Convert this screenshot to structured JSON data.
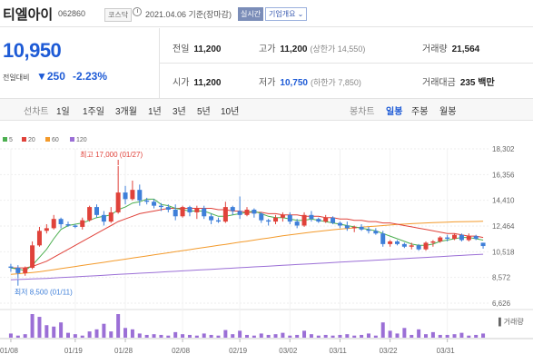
{
  "header": {
    "name": "티엘아이",
    "code": "062860",
    "market": "코스닥",
    "date": "2021.04.06 기준(장마감)",
    "live_btn": "실시간",
    "profile_btn": "기업개요 ⌄"
  },
  "price": {
    "current": "10,950",
    "change_label": "전일대비",
    "change": "▼250",
    "change_pct": "-2.23%"
  },
  "stats": {
    "prev_label": "전일",
    "prev": "11,200",
    "high_label": "고가",
    "high": "11,200",
    "high_sub": "(상한가 14,550)",
    "volume_label": "거래량",
    "volume": "21,564",
    "open_label": "시가",
    "open": "11,200",
    "low_label": "저가",
    "low": "10,750",
    "low_sub": "(하한가 7,850)",
    "amount_label": "거래대금",
    "amount": "235 백만"
  },
  "tabs": {
    "line": "선차트",
    "d1": "1일",
    "w1": "1주일",
    "m3": "3개월",
    "y1": "1년",
    "y3": "3년",
    "y5": "5년",
    "y10": "10년",
    "candle": "봉차트",
    "daily": "일봉",
    "weekly": "주봉",
    "monthly": "월봉"
  },
  "legend": [
    {
      "label": "5",
      "color": "#4caf50"
    },
    {
      "label": "20",
      "color": "#e0423a"
    },
    {
      "label": "60",
      "color": "#f39a2b"
    },
    {
      "label": "120",
      "color": "#9b6fd6"
    }
  ],
  "colors": {
    "up": "#e0423a",
    "down": "#3e7fd9",
    "volume": "#9b6fd6"
  },
  "chart_data": {
    "type": "candlestick",
    "y_ticks": [
      "18,302",
      "16,356",
      "14,410",
      "12,464",
      "10,518",
      "8,572",
      "6,626"
    ],
    "x_ticks": [
      "01/08",
      "01/19",
      "01/28",
      "02/08",
      "02/19",
      "03/02",
      "03/11",
      "03/22",
      "03/31"
    ],
    "ylim": [
      6626,
      18302
    ],
    "high_annotation": "최고 17,000 (01/27)",
    "low_annotation": "최저 8,500 (01/11)",
    "volume_label": "▌거래량",
    "candles": [
      {
        "o": 9400,
        "h": 9600,
        "l": 9000,
        "c": 9300
      },
      {
        "o": 9300,
        "h": 9500,
        "l": 8500,
        "c": 8900
      },
      {
        "o": 8900,
        "h": 9400,
        "l": 8700,
        "c": 9300
      },
      {
        "o": 9300,
        "h": 11300,
        "l": 9200,
        "c": 11000
      },
      {
        "o": 11000,
        "h": 12400,
        "l": 10900,
        "c": 12100
      },
      {
        "o": 12100,
        "h": 12600,
        "l": 11900,
        "c": 12300
      },
      {
        "o": 12300,
        "h": 13300,
        "l": 12200,
        "c": 13000
      },
      {
        "o": 13000,
        "h": 13100,
        "l": 12300,
        "c": 12600
      },
      {
        "o": 12600,
        "h": 12800,
        "l": 12400,
        "c": 12500
      },
      {
        "o": 12500,
        "h": 12600,
        "l": 12300,
        "c": 12400
      },
      {
        "o": 12400,
        "h": 13100,
        "l": 12200,
        "c": 12900
      },
      {
        "o": 12900,
        "h": 14000,
        "l": 12800,
        "c": 13900
      },
      {
        "o": 13900,
        "h": 14100,
        "l": 13100,
        "c": 13300
      },
      {
        "o": 13300,
        "h": 13600,
        "l": 12500,
        "c": 12800
      },
      {
        "o": 12800,
        "h": 13900,
        "l": 12700,
        "c": 13500
      },
      {
        "o": 13500,
        "h": 17000,
        "l": 13400,
        "c": 15000
      },
      {
        "o": 15000,
        "h": 15500,
        "l": 14100,
        "c": 14500
      },
      {
        "o": 14500,
        "h": 15900,
        "l": 14400,
        "c": 15200
      },
      {
        "o": 15200,
        "h": 15600,
        "l": 14000,
        "c": 14400
      },
      {
        "o": 14400,
        "h": 14600,
        "l": 14100,
        "c": 14300
      },
      {
        "o": 14300,
        "h": 14500,
        "l": 13800,
        "c": 14000
      },
      {
        "o": 14000,
        "h": 14200,
        "l": 13600,
        "c": 13900
      },
      {
        "o": 13900,
        "h": 14100,
        "l": 13500,
        "c": 13700
      },
      {
        "o": 13700,
        "h": 14100,
        "l": 12900,
        "c": 13200
      },
      {
        "o": 13200,
        "h": 14000,
        "l": 13100,
        "c": 13900
      },
      {
        "o": 13900,
        "h": 14000,
        "l": 13200,
        "c": 13500
      },
      {
        "o": 13500,
        "h": 14000,
        "l": 13000,
        "c": 13800
      },
      {
        "o": 13800,
        "h": 14000,
        "l": 13000,
        "c": 13200
      },
      {
        "o": 13200,
        "h": 13400,
        "l": 12600,
        "c": 12900
      },
      {
        "o": 12900,
        "h": 13100,
        "l": 12700,
        "c": 12800
      },
      {
        "o": 12800,
        "h": 14300,
        "l": 12700,
        "c": 13900
      },
      {
        "o": 13900,
        "h": 14000,
        "l": 13300,
        "c": 13600
      },
      {
        "o": 13600,
        "h": 14700,
        "l": 13000,
        "c": 13300
      },
      {
        "o": 13300,
        "h": 13900,
        "l": 13200,
        "c": 13700
      },
      {
        "o": 13700,
        "h": 13800,
        "l": 13100,
        "c": 13400
      },
      {
        "o": 13400,
        "h": 13500,
        "l": 12700,
        "c": 12900
      },
      {
        "o": 12900,
        "h": 13000,
        "l": 12500,
        "c": 12800
      },
      {
        "o": 12800,
        "h": 13300,
        "l": 12600,
        "c": 13100
      },
      {
        "o": 13100,
        "h": 13500,
        "l": 12800,
        "c": 13300
      },
      {
        "o": 13300,
        "h": 13500,
        "l": 12600,
        "c": 12800
      },
      {
        "o": 12800,
        "h": 13000,
        "l": 12300,
        "c": 12500
      },
      {
        "o": 12500,
        "h": 13500,
        "l": 12400,
        "c": 13300
      },
      {
        "o": 13300,
        "h": 13600,
        "l": 12800,
        "c": 13000
      },
      {
        "o": 13000,
        "h": 13100,
        "l": 12700,
        "c": 12800
      },
      {
        "o": 12800,
        "h": 13300,
        "l": 12700,
        "c": 13100
      },
      {
        "o": 13100,
        "h": 13200,
        "l": 12600,
        "c": 12700
      },
      {
        "o": 12700,
        "h": 12800,
        "l": 12300,
        "c": 12500
      },
      {
        "o": 12500,
        "h": 12800,
        "l": 12100,
        "c": 12300
      },
      {
        "o": 12300,
        "h": 12500,
        "l": 12000,
        "c": 12400
      },
      {
        "o": 12400,
        "h": 12600,
        "l": 12100,
        "c": 12200
      },
      {
        "o": 12200,
        "h": 12400,
        "l": 11900,
        "c": 12100
      },
      {
        "o": 12100,
        "h": 12300,
        "l": 11800,
        "c": 11900
      },
      {
        "o": 11900,
        "h": 12100,
        "l": 10900,
        "c": 11100
      },
      {
        "o": 11100,
        "h": 11400,
        "l": 10900,
        "c": 11300
      },
      {
        "o": 11300,
        "h": 11400,
        "l": 11000,
        "c": 11100
      },
      {
        "o": 11100,
        "h": 11200,
        "l": 10800,
        "c": 10900
      },
      {
        "o": 10900,
        "h": 11200,
        "l": 10700,
        "c": 11000
      },
      {
        "o": 11000,
        "h": 11100,
        "l": 10600,
        "c": 10700
      },
      {
        "o": 10700,
        "h": 11300,
        "l": 10600,
        "c": 11200
      },
      {
        "o": 11200,
        "h": 11400,
        "l": 10900,
        "c": 11300
      },
      {
        "o": 11300,
        "h": 11700,
        "l": 11200,
        "c": 11600
      },
      {
        "o": 11600,
        "h": 11800,
        "l": 11300,
        "c": 11500
      },
      {
        "o": 11500,
        "h": 11900,
        "l": 11400,
        "c": 11800
      },
      {
        "o": 11800,
        "h": 11900,
        "l": 11300,
        "c": 11400
      },
      {
        "o": 11400,
        "h": 11900,
        "l": 11300,
        "c": 11700
      },
      {
        "o": 11700,
        "h": 11800,
        "l": 11400,
        "c": 11500
      },
      {
        "o": 11200,
        "h": 11200,
        "l": 10750,
        "c": 10950
      }
    ],
    "volumes": [
      6,
      3,
      5,
      34,
      30,
      18,
      16,
      22,
      7,
      5,
      3,
      9,
      12,
      20,
      9,
      34,
      14,
      12,
      6,
      4,
      5,
      4,
      3,
      8,
      5,
      4,
      3,
      6,
      4,
      3,
      11,
      5,
      10,
      4,
      3,
      6,
      4,
      5,
      7,
      3,
      4,
      10,
      5,
      3,
      4,
      3,
      4,
      5,
      3,
      4,
      6,
      3,
      22,
      10,
      6,
      14,
      4,
      12,
      5,
      8,
      4,
      4,
      5,
      7,
      3,
      4,
      6
    ],
    "ma5": [
      9300,
      9200,
      9100,
      9500,
      10100,
      10700,
      11500,
      12200,
      12500,
      12600,
      12700,
      12900,
      13100,
      13200,
      13300,
      13700,
      13900,
      14200,
      14300,
      14500,
      14500,
      14100,
      14000,
      13800,
      13700,
      13600,
      13600,
      13600,
      13400,
      13200,
      13200,
      13300,
      13400,
      13500,
      13600,
      13400,
      13200,
      13100,
      13100,
      13000,
      12900,
      12900,
      13000,
      12900,
      12800,
      12700,
      12600,
      12500,
      12400,
      12300,
      12200,
      12100,
      11900,
      11700,
      11500,
      11300,
      11100,
      11000,
      11000,
      11100,
      11300,
      11400,
      11500,
      11600,
      11600,
      11500,
      11400
    ],
    "ma20": [
      9300,
      9300,
      9300,
      9400,
      9600,
      9800,
      10100,
      10400,
      10700,
      11000,
      11300,
      11600,
      11900,
      12200,
      12500,
      12800,
      13000,
      13200,
      13400,
      13500,
      13600,
      13700,
      13800,
      13800,
      13800,
      13800,
      13800,
      13800,
      13800,
      13700,
      13700,
      13600,
      13600,
      13500,
      13500,
      13500,
      13400,
      13400,
      13300,
      13300,
      13300,
      13200,
      13200,
      13200,
      13100,
      13100,
      13000,
      13000,
      12900,
      12900,
      12800,
      12800,
      12700,
      12700,
      12600,
      12500,
      12400,
      12300,
      12200,
      12100,
      12000,
      11900,
      11900,
      11800,
      11700,
      11700,
      11600
    ],
    "ma60": [
      8800,
      8850,
      8900,
      8950,
      9000,
      9080,
      9160,
      9240,
      9320,
      9400,
      9480,
      9560,
      9640,
      9720,
      9800,
      9880,
      9960,
      10040,
      10120,
      10200,
      10280,
      10360,
      10440,
      10520,
      10600,
      10680,
      10760,
      10840,
      10920,
      11000,
      11080,
      11160,
      11240,
      11320,
      11400,
      11480,
      11560,
      11640,
      11720,
      11790,
      11860,
      11930,
      12000,
      12060,
      12120,
      12180,
      12230,
      12280,
      12330,
      12380,
      12420,
      12460,
      12500,
      12540,
      12580,
      12610,
      12640,
      12670,
      12700,
      12720,
      12740,
      12760,
      12780,
      12790,
      12800,
      12810,
      12820
    ],
    "ma120": [
      8400,
      8420,
      8440,
      8460,
      8480,
      8500,
      8530,
      8560,
      8590,
      8620,
      8650,
      8680,
      8710,
      8740,
      8770,
      8800,
      8830,
      8860,
      8890,
      8920,
      8950,
      8980,
      9010,
      9040,
      9070,
      9100,
      9130,
      9160,
      9190,
      9220,
      9250,
      9280,
      9310,
      9340,
      9370,
      9400,
      9430,
      9460,
      9490,
      9520,
      9550,
      9580,
      9610,
      9640,
      9670,
      9700,
      9730,
      9760,
      9790,
      9820,
      9850,
      9880,
      9910,
      9940,
      9970,
      10000,
      10030,
      10060,
      10090,
      10120,
      10150,
      10180,
      10210,
      10240,
      10270,
      10300,
      10330
    ]
  }
}
